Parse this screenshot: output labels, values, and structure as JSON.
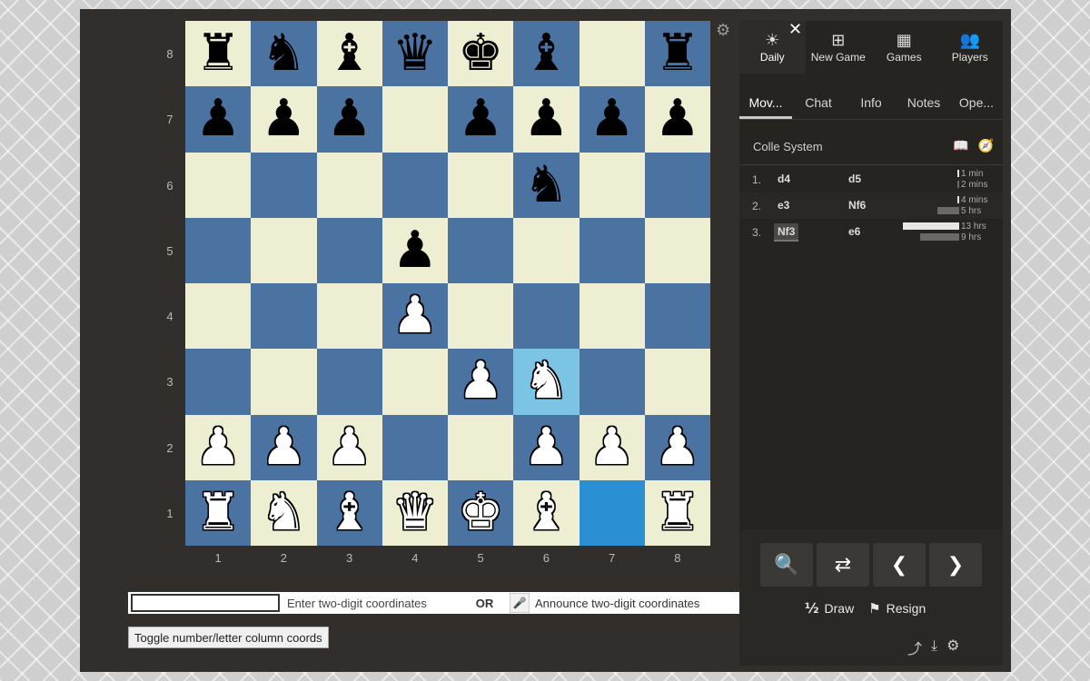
{
  "board": {
    "ranks": [
      "8",
      "7",
      "6",
      "5",
      "4",
      "3",
      "2",
      "1"
    ],
    "files": [
      "1",
      "2",
      "3",
      "4",
      "5",
      "6",
      "7",
      "8"
    ],
    "squares": [
      [
        "bR",
        "bN",
        "bB",
        "bQ",
        "bK",
        "bB",
        "",
        "bR"
      ],
      [
        "bP",
        "bP",
        "bP",
        "",
        "bP",
        "bP",
        "bP",
        "bP"
      ],
      [
        "",
        "",
        "",
        "",
        "",
        "bN",
        "",
        ""
      ],
      [
        "",
        "",
        "",
        "bP",
        "",
        "",
        "",
        ""
      ],
      [
        "",
        "",
        "",
        "wP",
        "",
        "",
        "",
        ""
      ],
      [
        "",
        "",
        "",
        "",
        "wP",
        "wN",
        "",
        ""
      ],
      [
        "wP",
        "wP",
        "wP",
        "",
        "",
        "wP",
        "wP",
        "wP"
      ],
      [
        "wR",
        "wN",
        "wB",
        "wQ",
        "wK",
        "wB",
        "",
        "wR"
      ]
    ],
    "highlight": "f3",
    "selected": "g1",
    "glyphs": {
      "K": "♚",
      "Q": "♛",
      "R": "♜",
      "B": "♝",
      "N": "♞",
      "P": "♟"
    },
    "settings_icon": "gear-icon"
  },
  "coordinates": {
    "input_value": "",
    "input_hint": "Enter two-digit coordinates",
    "or_label": "OR",
    "voice_hint": "Announce two-digit coordinates",
    "mic_icon": "microphone-icon",
    "toggle_label": "Toggle number/letter column coords"
  },
  "panel": {
    "close_icon": "close-icon",
    "nav": [
      {
        "label": "Daily",
        "icon": "sun-icon",
        "glyph": "☀"
      },
      {
        "label": "New Game",
        "icon": "plus-icon",
        "glyph": "⊞"
      },
      {
        "label": "Games",
        "icon": "board-icon",
        "glyph": "▦"
      },
      {
        "label": "Players",
        "icon": "players-icon",
        "glyph": "👥"
      }
    ],
    "tabs": [
      "Mov...",
      "Chat",
      "Info",
      "Notes",
      "Ope..."
    ],
    "opening": "Colle System",
    "moves": [
      {
        "num": "1.",
        "white": "d4",
        "black": "d5",
        "t1": "1 min",
        "t2": "2 mins",
        "w1": 0.01,
        "w2": 0.01
      },
      {
        "num": "2.",
        "white": "e3",
        "black": "Nf6",
        "t1": "4 mins",
        "t2": "5 hrs",
        "w1": 0.01,
        "w2": 0.38
      },
      {
        "num": "3.",
        "white": "Nf3",
        "black": "e6",
        "t1": "13 hrs",
        "t2": "9 hrs",
        "w1": 1.0,
        "w2": 0.69
      }
    ],
    "controls": {
      "buttons": [
        {
          "name": "analysis-button",
          "glyph": "🔍"
        },
        {
          "name": "share-branch-button",
          "glyph": "⇄"
        },
        {
          "name": "previous-move-button",
          "glyph": "❮"
        },
        {
          "name": "next-move-button",
          "glyph": "❯"
        }
      ],
      "draw_icon": "½",
      "draw_label": "Draw",
      "resign_icon": "⚑",
      "resign_label": "Resign"
    }
  },
  "colors": {
    "light": "#eeeed2",
    "dark": "#4b73a2",
    "highlight": "#7bc4e4",
    "selected": "#2b8fd4"
  }
}
